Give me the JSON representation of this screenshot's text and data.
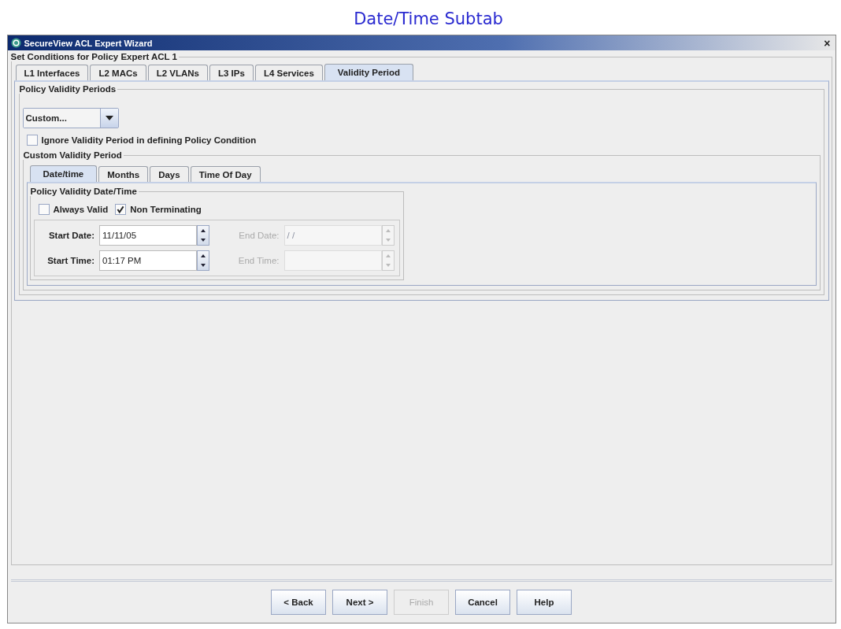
{
  "caption": "Date/Time Subtab",
  "window": {
    "title": "SecureView ACL Expert Wizard",
    "close": "×"
  },
  "conditions_group": {
    "title": "Set Conditions for Policy Expert ACL 1"
  },
  "tabs": [
    {
      "label": "L1 Interfaces",
      "selected": false
    },
    {
      "label": "L2 MACs",
      "selected": false
    },
    {
      "label": "L2 VLANs",
      "selected": false
    },
    {
      "label": "L3 IPs",
      "selected": false
    },
    {
      "label": "L4 Services",
      "selected": false
    },
    {
      "label": "Validity Period",
      "selected": true
    }
  ],
  "periods_group": {
    "title": "Policy Validity Periods",
    "combo_value": "Custom...",
    "ignore": {
      "label": "Ignore Validity Period in defining Policy Condition",
      "checked": false
    }
  },
  "custom_group": {
    "title": "Custom Validity Period"
  },
  "subtabs": [
    {
      "label": "Date/time",
      "selected": true
    },
    {
      "label": "Months",
      "selected": false
    },
    {
      "label": "Days",
      "selected": false
    },
    {
      "label": "Time Of Day",
      "selected": false
    }
  ],
  "datetime_group": {
    "title": "Policy Validity Date/Time",
    "checks": [
      {
        "label": "Always Valid",
        "checked": false
      },
      {
        "label": "Non Terminating",
        "checked": true
      }
    ],
    "fields": [
      {
        "label": "Start Date:",
        "value": "11/11/05",
        "disabled": false
      },
      {
        "label": "End Date:",
        "value": "/ /",
        "disabled": true
      },
      {
        "label": "Start Time:",
        "value": "01:17 PM",
        "disabled": false
      },
      {
        "label": "End Time:",
        "disabled": true
      }
    ]
  },
  "buttons": [
    {
      "label": "< Back",
      "disabled": false
    },
    {
      "label": "Next >",
      "disabled": false
    },
    {
      "label": "Finish",
      "disabled": true
    },
    {
      "label": "Cancel",
      "disabled": false
    },
    {
      "label": "Help",
      "disabled": false
    }
  ]
}
